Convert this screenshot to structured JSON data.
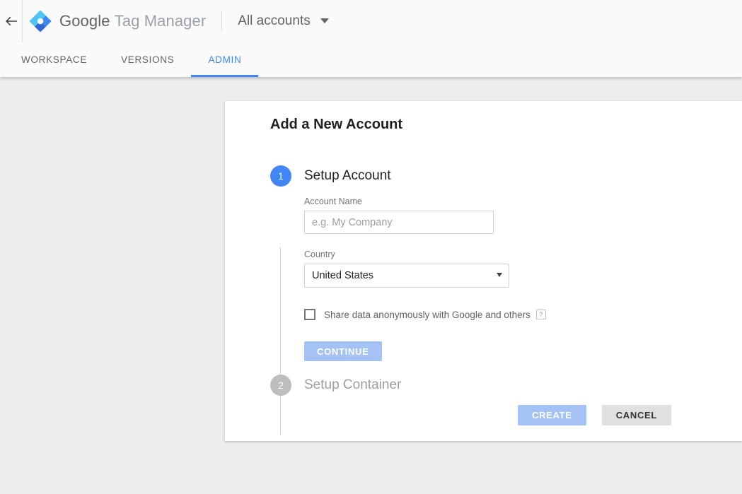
{
  "header": {
    "back_icon": "back-arrow-icon",
    "logo_icon": "google-tag-manager-logo",
    "brand_primary": "Google",
    "brand_secondary": "Tag Manager",
    "account_selector": "All accounts",
    "account_caret_icon": "chevron-down-icon"
  },
  "tabs": [
    {
      "label": "WORKSPACE",
      "active": false
    },
    {
      "label": "VERSIONS",
      "active": false
    },
    {
      "label": "ADMIN",
      "active": true
    }
  ],
  "card": {
    "title": "Add a New Account",
    "steps": [
      {
        "number": "1",
        "label": "Setup Account",
        "active": true
      },
      {
        "number": "2",
        "label": "Setup Container",
        "active": false
      }
    ],
    "form": {
      "account_name_label": "Account Name",
      "account_name_value": "",
      "account_name_placeholder": "e.g. My Company",
      "country_label": "Country",
      "country_value": "United States",
      "country_caret_icon": "select-caret-icon",
      "share_data_label": "Share data anonymously with Google and others",
      "share_data_checked": false,
      "help_icon_glyph": "?",
      "continue_label": "CONTINUE"
    },
    "actions": {
      "create_label": "CREATE",
      "cancel_label": "CANCEL"
    }
  },
  "colors": {
    "accent_blue": "#4285f4",
    "muted_blue": "#a4c2f4",
    "page_background": "#ededed",
    "bar_background": "#fafafa",
    "inactive_gray": "#bdbdbd"
  }
}
